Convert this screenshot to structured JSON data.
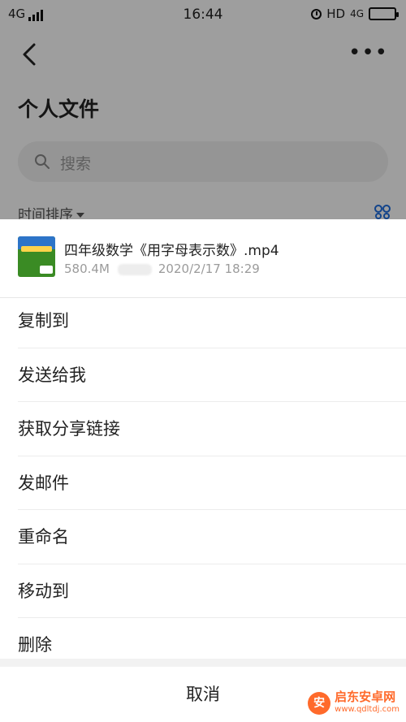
{
  "status_bar": {
    "network": "4G",
    "time": "16:44",
    "right_label": "HD",
    "right_network": "4G"
  },
  "header": {
    "title": "个人文件",
    "more": "•••"
  },
  "search": {
    "placeholder": "搜索"
  },
  "sort": {
    "label": "时间排序"
  },
  "file": {
    "name": "四年级数学《用字母表示数》.mp4",
    "size": "580.4M",
    "date": "2020/2/17 18:29"
  },
  "menu": {
    "items": [
      {
        "label": "复制到"
      },
      {
        "label": "发送给我"
      },
      {
        "label": "获取分享链接"
      },
      {
        "label": "发邮件"
      },
      {
        "label": "重命名"
      },
      {
        "label": "移动到"
      },
      {
        "label": "删除"
      }
    ],
    "cancel": "取消"
  },
  "watermark": {
    "name": "启东安卓网",
    "url": "www.qdltdj.com"
  },
  "colors": {
    "overlay": "#000000",
    "sheet_bg": "#ffffff",
    "watermark": "#ff6a2b"
  }
}
